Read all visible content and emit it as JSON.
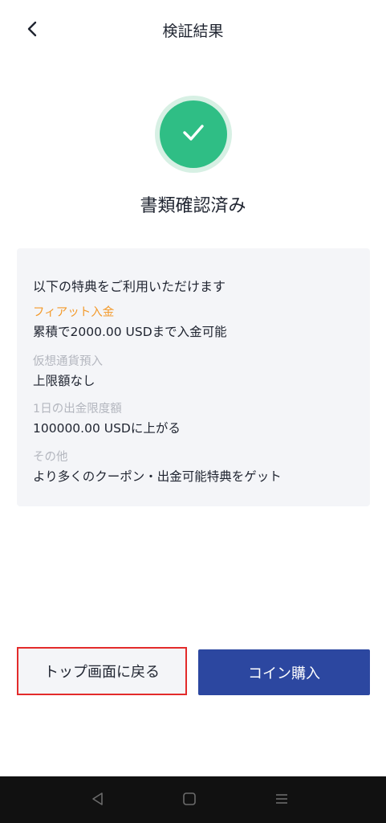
{
  "header": {
    "title": "検証結果",
    "back_icon": "chevron-left-icon"
  },
  "status": {
    "icon": "check-icon",
    "text": "書類確認済み",
    "colors": {
      "outer": "#d7f0e4",
      "inner": "#2fbe85"
    }
  },
  "benefits": {
    "heading": "以下の特典をご利用いただけます",
    "items": [
      {
        "label": "フィアット入金",
        "value": "累積で2000.00 USDまで入金可能"
      },
      {
        "label": "仮想通貨預入",
        "value": "上限額なし"
      },
      {
        "label": "1日の出金限度額",
        "value": "100000.00 USDに上がる"
      },
      {
        "label": "その他",
        "value": "より多くのクーポン・出金可能特典をゲット"
      }
    ]
  },
  "actions": {
    "home_label": "トップ画面に戻る",
    "buy_label": "コイン購入",
    "buy_color": "#2c47a0",
    "highlight_color": "#e32b2b"
  },
  "system_nav": {
    "back_icon": "triangle-back-icon",
    "home_icon": "square-home-icon",
    "menu_icon": "menu-lines-icon"
  }
}
